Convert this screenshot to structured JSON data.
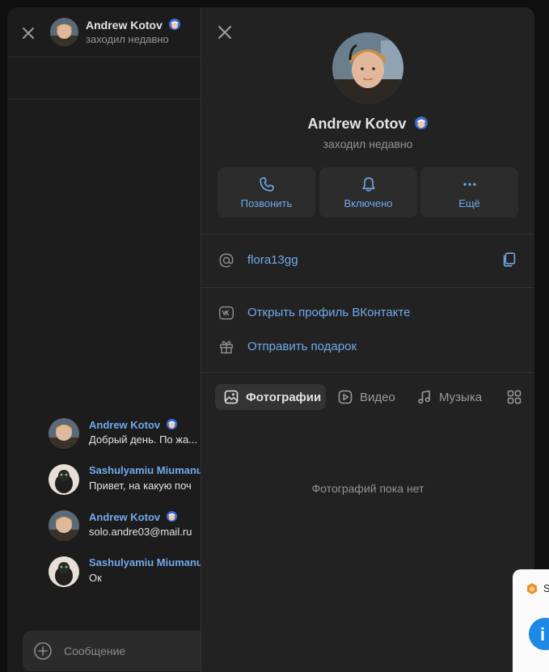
{
  "chat": {
    "header": {
      "name": "Andrew Kotov",
      "status": "заходил недавно"
    },
    "messages": [
      {
        "author": "Andrew Kotov",
        "text": "Добрый день. По жа..."
      },
      {
        "author": "Sashulyamiu Miumanu",
        "text": "Привет, на какую поч"
      },
      {
        "author": "Andrew Kotov",
        "text": "solo.andre03@mail.ru"
      },
      {
        "author": "Sashulyamiu Miumanu",
        "text": "Ок"
      }
    ],
    "composer": {
      "placeholder": "Сообщение"
    }
  },
  "profile": {
    "name": "Andrew Kotov",
    "status": "заходил недавно",
    "actions": [
      {
        "label": "Позвонить",
        "icon": "phone-icon"
      },
      {
        "label": "Включено",
        "icon": "bell-icon"
      },
      {
        "label": "Ещё",
        "icon": "more-icon"
      }
    ],
    "username": "flora13gg",
    "links": [
      {
        "label": "Открыть профиль ВКонтакте",
        "icon": "vk-icon"
      },
      {
        "label": "Отправить подарок",
        "icon": "gift-icon"
      }
    ],
    "tabs": [
      {
        "label": "Фотографии",
        "icon": "photo-icon",
        "active": true
      },
      {
        "label": "Видео",
        "icon": "video-icon",
        "active": false
      },
      {
        "label": "Музыка",
        "icon": "music-icon",
        "active": false
      },
      {
        "label": "",
        "icon": "apps-icon",
        "active": false
      }
    ],
    "empty_text": "Фотографий пока нет"
  },
  "toast": {
    "text": "S",
    "button_glyph": "i"
  },
  "colors": {
    "accent": "#71aaeb",
    "background": "#1c1c1c",
    "panel": "#222222",
    "badge": "#1e88e5"
  }
}
